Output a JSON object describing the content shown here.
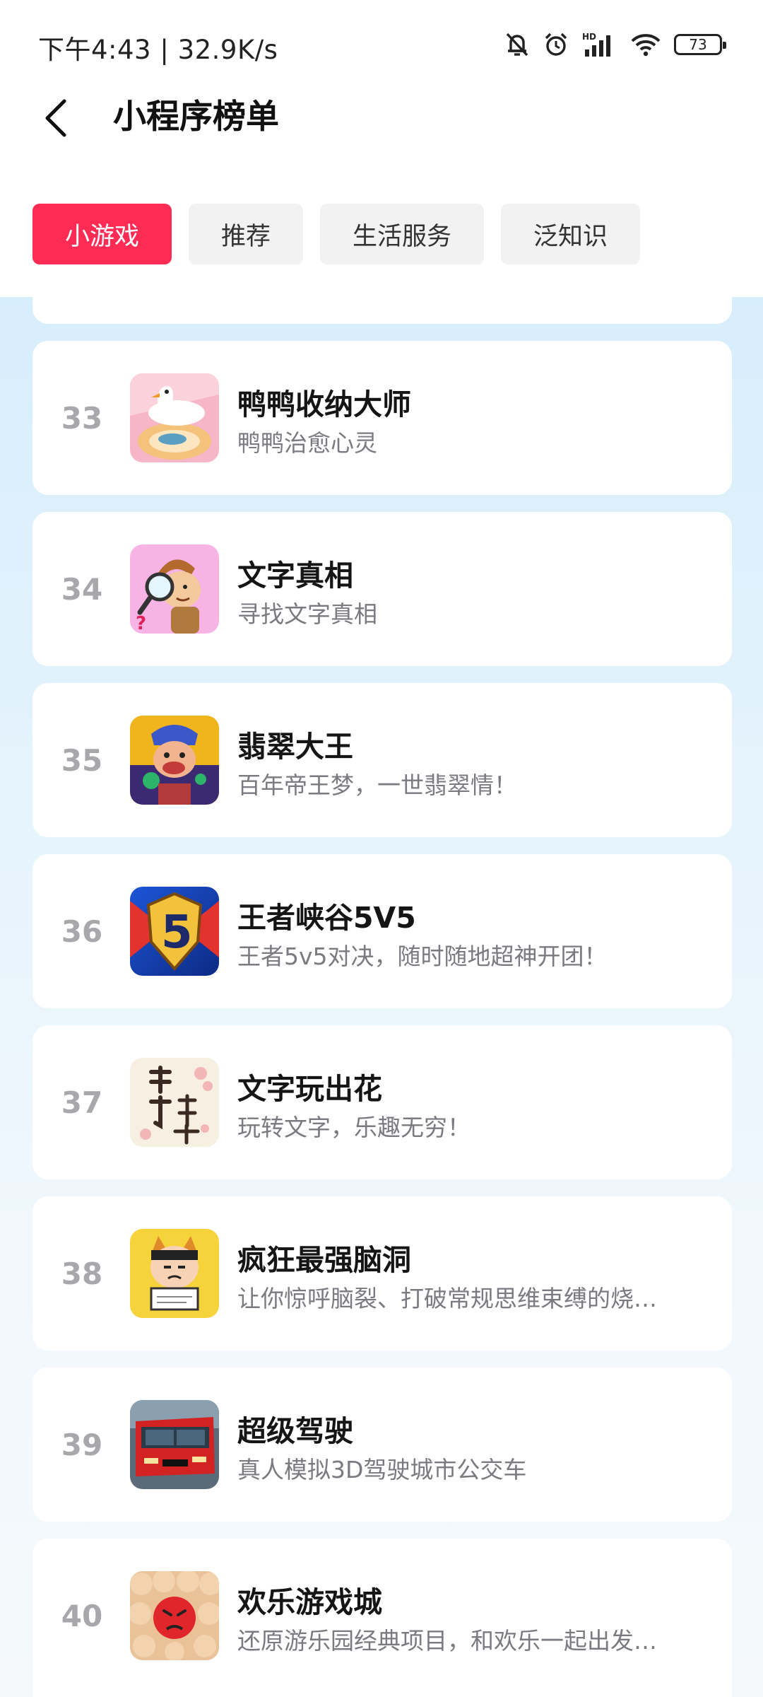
{
  "status_bar": {
    "time_speed": "下午4:43 | 32.9K/s",
    "battery": "73",
    "icons": [
      "mute-bell-icon",
      "alarm-icon",
      "hd-signal-icon",
      "wifi-icon",
      "battery-icon"
    ]
  },
  "header": {
    "title": "小程序榜单",
    "back_icon": "back-arrow-icon"
  },
  "tabs": [
    {
      "label": "小游戏",
      "active": true
    },
    {
      "label": "推荐",
      "active": false
    },
    {
      "label": "生活服务",
      "active": false
    },
    {
      "label": "泛知识",
      "active": false
    }
  ],
  "items": [
    {
      "rank": "33",
      "name": "鸭鸭收纳大师",
      "desc": "鸭鸭治愈心灵",
      "icon": "duck-storage-icon"
    },
    {
      "rank": "34",
      "name": "文字真相",
      "desc": "寻找文字真相",
      "icon": "detective-magnifier-icon"
    },
    {
      "rank": "35",
      "name": "翡翠大王",
      "desc": "百年帝王梦，一世翡翠情！",
      "icon": "jade-king-icon"
    },
    {
      "rank": "36",
      "name": "王者峡谷5V5",
      "desc": "王者5v5对决，随时随地超神开团！",
      "icon": "five-v-five-shield-icon"
    },
    {
      "rank": "37",
      "name": "文字玩出花",
      "desc": "玩转文字，乐趣无穷！",
      "icon": "calligraphy-flowers-icon"
    },
    {
      "rank": "38",
      "name": "疯狂最强脑洞",
      "desc": "让你惊呼脑裂、打破常规思维束缚的烧…",
      "icon": "brain-puzzle-cartoon-icon"
    },
    {
      "rank": "39",
      "name": "超级驾驶",
      "desc": "真人模拟3D驾驶城市公交车",
      "icon": "red-bus-icon"
    },
    {
      "rank": "40",
      "name": "欢乐游戏城",
      "desc": "还原游乐园经典项目，和欢乐一起出发…",
      "icon": "angry-crowd-icon"
    }
  ],
  "colors": {
    "accent": "#fe2c55",
    "tab_inactive_bg": "#f2f2f3",
    "rank_gray": "#a8a8ac",
    "background_top": "#cfeafb"
  }
}
